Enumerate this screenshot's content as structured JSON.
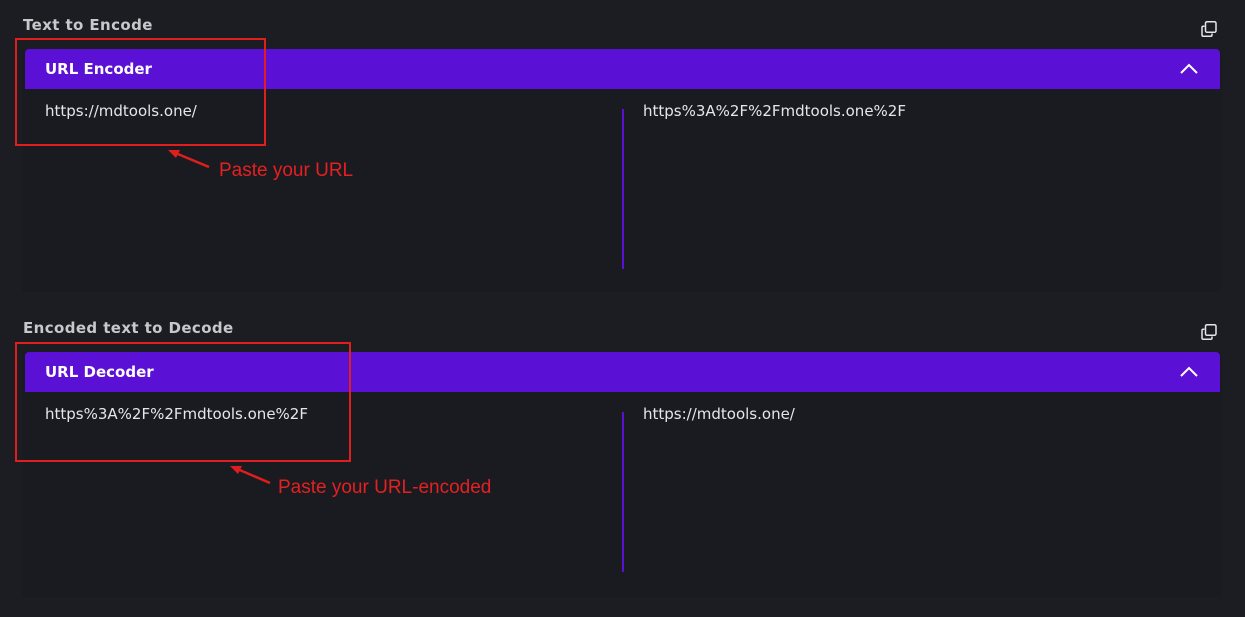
{
  "encoder": {
    "section_label": "Text to Encode",
    "panel_title": "URL Encoder",
    "input_value": "https://mdtools.one/",
    "output_value": "https%3A%2F%2Fmdtools.one%2F",
    "annotation": "Paste your URL"
  },
  "decoder": {
    "section_label": "Encoded text to Decode",
    "panel_title": "URL Decoder",
    "input_value": "https%3A%2F%2Fmdtools.one%2F",
    "output_value": "https://mdtools.one/",
    "annotation": "Paste your URL-encoded"
  },
  "colors": {
    "accent": "#5b10d6",
    "annotation": "#e42020",
    "background": "#1c1d22"
  },
  "icons": {
    "copy": "copy-icon",
    "collapse": "chevron-up-icon"
  }
}
